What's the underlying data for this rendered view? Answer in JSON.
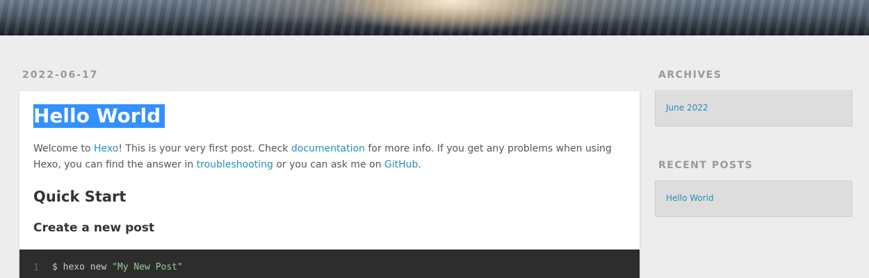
{
  "article": {
    "date": "2022-06-17",
    "title": "Hello World",
    "intro": {
      "p1": "Welcome to ",
      "link_hexo": "Hexo",
      "p2": "! This is your very first post. Check ",
      "link_docs": "documentation",
      "p3": " for more info. If you get any problems when using Hexo, you can find the answer in ",
      "link_trouble": "troubleshooting",
      "p4": " or you can ask me on ",
      "link_github": "GitHub",
      "p5": "."
    },
    "heading_quick_start": "Quick Start",
    "heading_create_post": "Create a new post",
    "code": {
      "line_number": "1",
      "command": "$ hexo new ",
      "string": "\"My New Post\""
    }
  },
  "sidebar": {
    "archives": {
      "title": "ARCHIVES",
      "items": [
        "June 2022"
      ]
    },
    "recent_posts": {
      "title": "RECENT POSTS",
      "items": [
        "Hello World"
      ]
    }
  },
  "colors": {
    "link": "#258fb8",
    "selection": "#3390ff",
    "code_bg": "#2d2d2d",
    "page_bg": "#ededed"
  }
}
